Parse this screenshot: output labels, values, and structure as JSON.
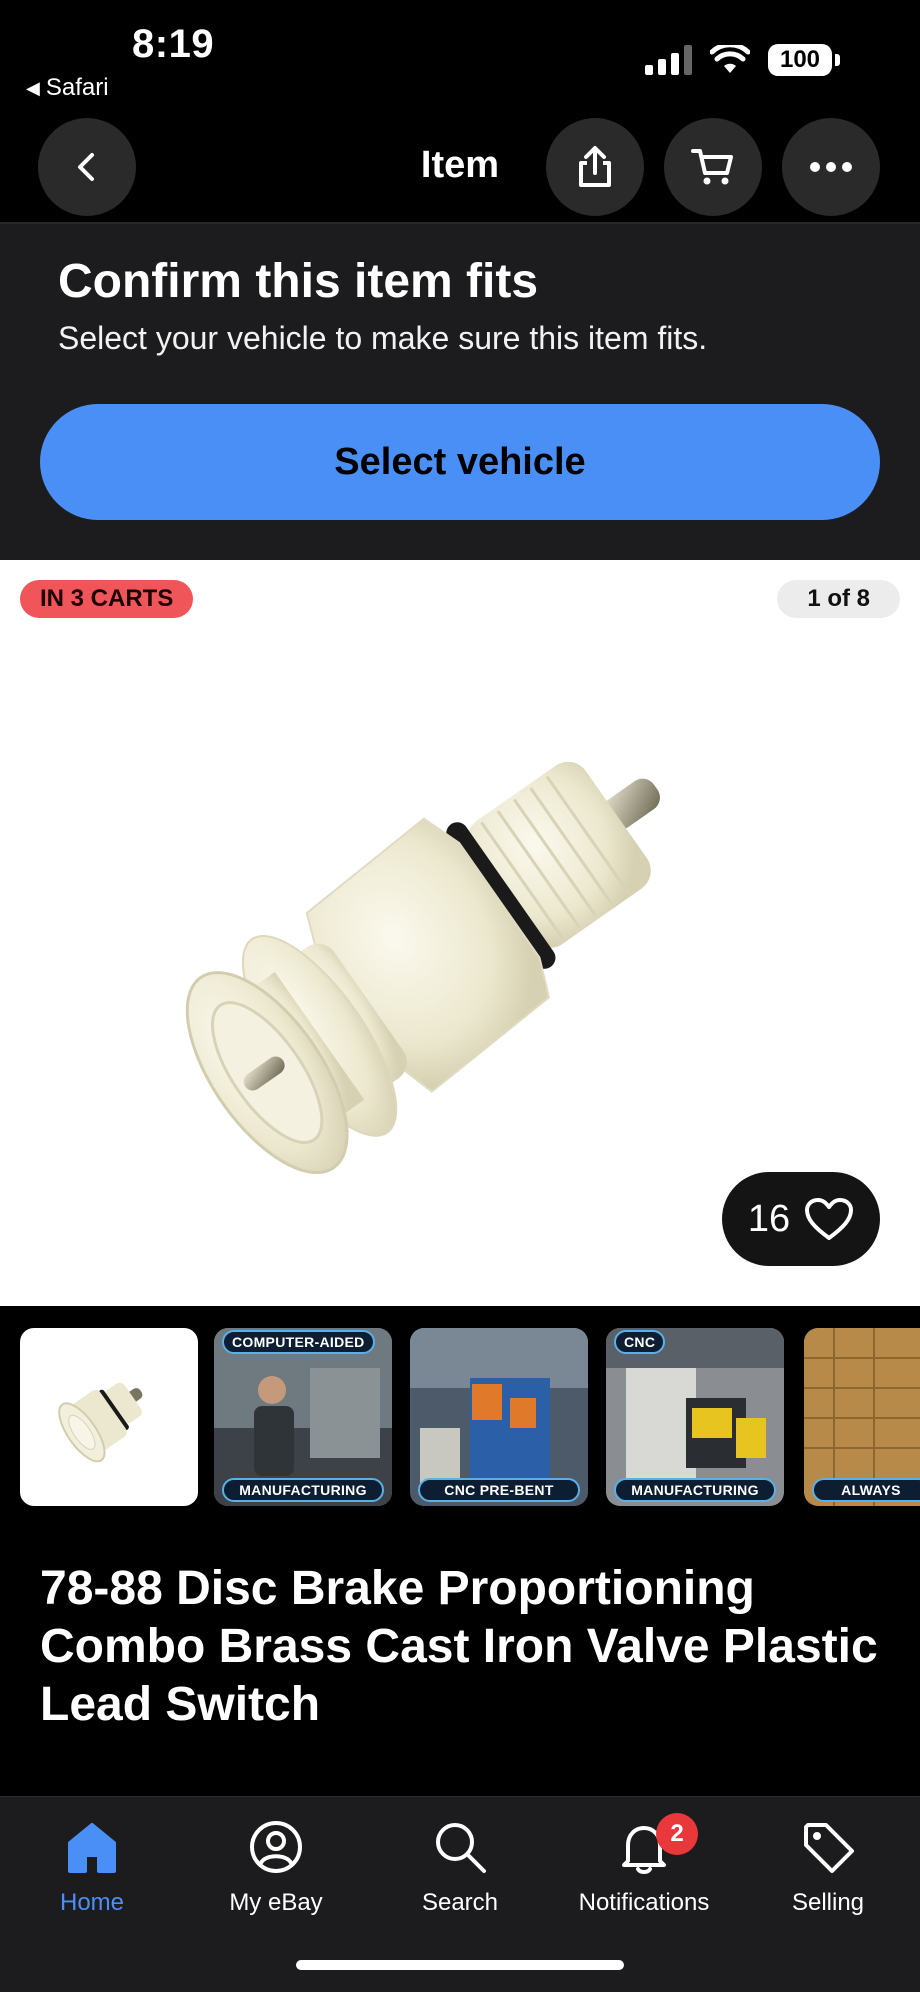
{
  "status_bar": {
    "time": "8:19",
    "back_app": "Safari",
    "battery": "100"
  },
  "nav": {
    "title": "Item",
    "back_icon": "chevron-left-icon",
    "share_icon": "share-icon",
    "cart_icon": "cart-icon",
    "more_icon": "ellipsis-icon"
  },
  "fit": {
    "title": "Confirm this item fits",
    "subtitle": "Select your vehicle to make sure this item fits.",
    "button_label": "Select vehicle"
  },
  "gallery": {
    "carts_badge": "IN 3 CARTS",
    "counter": "1 of 8",
    "watch_count": "16",
    "thumbnails": [
      {
        "top_caption": "",
        "bottom_caption": ""
      },
      {
        "top_caption": "COMPUTER-AIDED",
        "bottom_caption": "MANUFACTURING"
      },
      {
        "top_caption": "",
        "bottom_caption": "CNC PRE-BENT"
      },
      {
        "top_caption": "CNC",
        "bottom_caption": "MANUFACTURING"
      },
      {
        "top_caption": "",
        "bottom_caption": "ALWAYS"
      }
    ]
  },
  "item": {
    "title": "78-88 Disc Brake Proportioning Combo Brass Cast Iron Valve Plastic Lead Switch"
  },
  "tab_bar": {
    "tabs": [
      {
        "label": "Home",
        "icon": "home-icon"
      },
      {
        "label": "My eBay",
        "icon": "user-icon"
      },
      {
        "label": "Search",
        "icon": "search-icon"
      },
      {
        "label": "Notifications",
        "icon": "bell-icon"
      },
      {
        "label": "Selling",
        "icon": "tag-icon"
      }
    ],
    "notification_count": "2"
  },
  "colors": {
    "accent": "#4a8ff5",
    "badge_red": "#f0555a"
  }
}
